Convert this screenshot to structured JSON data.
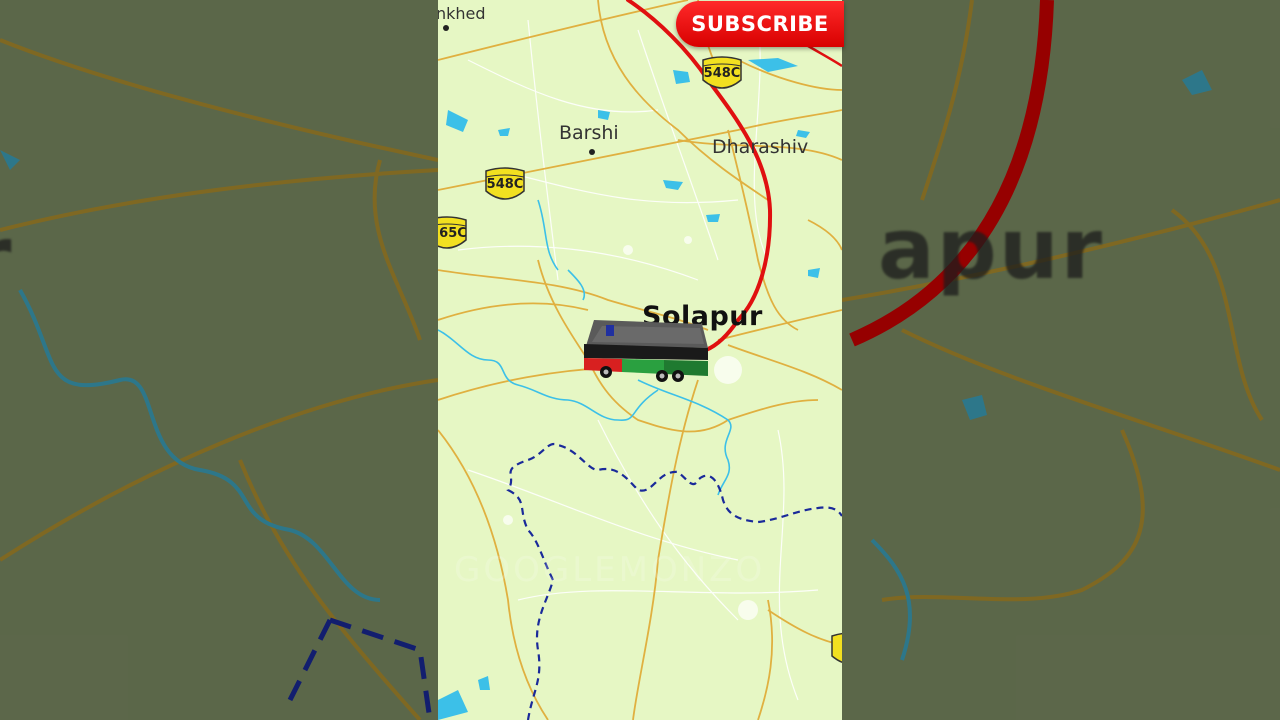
{
  "colors": {
    "land": "#e6f7c4",
    "road": "#e0b040",
    "route": "#e01010",
    "water": "#3cc0e8",
    "border": "#1a2a9a",
    "subscribe": "#e80000"
  },
  "map": {
    "labels": {
      "top_left_town": "nkhed",
      "barshi": "Barshi",
      "dharashiv": "Dharashiv",
      "solapur": "Solapur"
    },
    "highway_shields": {
      "nh_548c_top": "548C",
      "nh_548c_mid": "548C",
      "nh_65c": "65C"
    },
    "watermark": "GOOGLEMONZO",
    "vehicle_icon": "bus-icon"
  },
  "left_panel": {
    "text": "r"
  },
  "right_panel": {
    "text": "apur"
  },
  "overlay": {
    "subscribe_label": "SUBSCRIBE"
  }
}
